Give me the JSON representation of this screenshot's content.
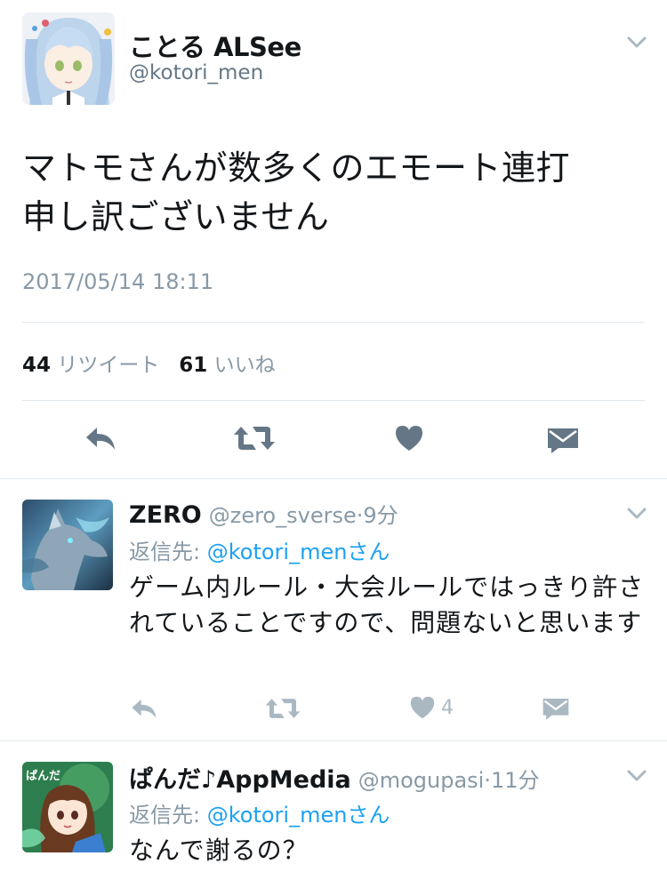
{
  "tweet": {
    "display_name": "ことる ALSee",
    "handle": "@kotori_men",
    "text_line1": "マトモさんが数多くのエモート連打",
    "text_line2": "申し訳ございません",
    "timestamp": "2017/05/14 18:11",
    "retweet_count": "44",
    "retweet_label": "リツイート",
    "like_count": "61",
    "like_label": "いいね"
  },
  "replies": [
    {
      "display_name": "ZERO",
      "handle": "@zero_sverse",
      "separator": "·",
      "time": "9分",
      "reply_prefix": "返信先: ",
      "reply_target": "@kotori_menさん",
      "text": "ゲーム内ルール・大会ルールではっきり許されていることですので、問題ないと思います",
      "like_count": "4"
    },
    {
      "display_name": "ぱんだ♪AppMedia",
      "handle": "@mogupasi",
      "separator": "·",
      "time": "11分",
      "reply_prefix": "返信先: ",
      "reply_target": "@kotori_menさん",
      "text": "なんで謝るの？",
      "avatar_text": "ぱんだ"
    }
  ],
  "colors": {
    "text": "#14171a",
    "secondary": "#657786",
    "muted": "#8899a6",
    "icon_main": "#657786",
    "icon_reply": "#aab8c2",
    "link": "#1da1f2",
    "divider": "#e1e8ed"
  },
  "icons": [
    "chevron-down-icon",
    "reply-icon",
    "retweet-icon",
    "like-icon",
    "direct-message-icon"
  ]
}
